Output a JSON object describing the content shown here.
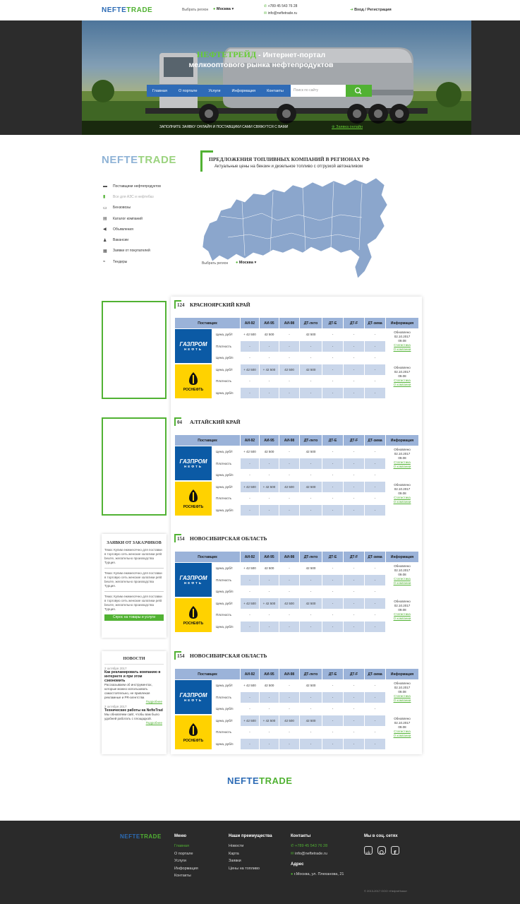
{
  "header": {
    "logo_part1": "NEFTE",
    "logo_part2": "TRADE",
    "region_label": "Выбрать регион",
    "region_value": "Москва",
    "phone": "+789 45 543 76 28",
    "email": "info@neftetrade.ru",
    "login": "Вход / Регистрация"
  },
  "hero": {
    "brand": "НЕФТЕТРЕЙД",
    "title_rest": " - Интернет-портал",
    "title_line2": "мелкооптового рынка нефтепродуктов",
    "nav": [
      "Главная",
      "О портале",
      "Услуги",
      "Информация",
      "Контакты"
    ],
    "search_placeholder": "Поиск по сайту",
    "strip_text": "ЗАПОЛНИТЕ ЗАЯВКУ ОНЛАЙН И ПОСТАВЩИКИ САМИ СВЯЖУТСЯ С ВАМИ",
    "strip_link": "Заявка онлайн"
  },
  "sidebar": {
    "logo_part1": "NEFTE",
    "logo_part2": "TRADE",
    "menu": [
      {
        "label": "Поставщики нефтепродуктов",
        "icon": "truck-icon"
      },
      {
        "label": "Все для АЗС и нефтебаз",
        "icon": "fuel-pump-icon"
      },
      {
        "label": "Бензовозы",
        "icon": "tanker-icon"
      },
      {
        "label": "Каталог компаний",
        "icon": "catalog-icon"
      },
      {
        "label": "Объявления",
        "icon": "megaphone-icon"
      },
      {
        "label": "Вакансии",
        "icon": "person-icon"
      },
      {
        "label": "Заявки от покупателей",
        "icon": "documents-icon"
      },
      {
        "label": "Тендеры",
        "icon": "handshake-icon"
      }
    ]
  },
  "offers": {
    "title": "ПРЕДЛОЖЕНИЯ ТОПЛИВНЫХ КОМПАНИЙ В РЕГИОНАХ РФ",
    "subtitle": "Актуальные цены на бензин и дизельное топливо с отгрузкой автоналивом",
    "region_label": "Выбрать регион",
    "region_value": "Москва"
  },
  "table_headers": [
    "Поставщик",
    "АИ-92",
    "АИ-95",
    "АИ-98",
    "ДТ-лето",
    "ДТ-Е",
    "ДТ-F",
    "ДТ-зима",
    "Информация"
  ],
  "row_labels": [
    "Цена, руб/т",
    "Плотность",
    "Цена, руб/л"
  ],
  "info": {
    "updated": "Обновлено 02.10.2017",
    "time": "09.08",
    "stats": "Статистика",
    "about": "О компании"
  },
  "suppliers": {
    "gazprom": {
      "line1": "ГАЗПРОМ",
      "line2": "НЕФТЬ"
    },
    "rosneft": {
      "line1": "РОСНЕФТЬ"
    }
  },
  "values": {
    "a": "+ 42 500",
    "b": "42 500",
    "dash": "-"
  },
  "sections": [
    {
      "num": "124",
      "name": "КРАСНОЯРСКИЙ КРАЙ"
    },
    {
      "num": "04",
      "name": "АЛТАЙСКИЙ КРАЙ"
    },
    {
      "num": "154",
      "name": "НОВОСИБИРСКАЯ ОБЛАСТЬ"
    },
    {
      "num": "154",
      "name": "НОВОСИБИРСКАЯ ОБЛАСТЬ"
    }
  ],
  "orders": {
    "title": "ЗАЯВКИ ОТ ЗАКАЗЧИКОВ",
    "items": [
      "Тема: Купим ежемесячно для поставки в торговую сеть женские халатики petit beurre, желательно производства Турция.",
      "Тема: Купим ежемесячно для поставки в торговую сеть женские халатики petit beurre, желательно производства Турция.",
      "Тема: Купим ежемесячно для поставки в торговую сеть женские халатики petit beurre, желательно производства Турция."
    ],
    "button": "Спрос на товары и услуги"
  },
  "news": {
    "title": "НОВОСТИ",
    "items": [
      {
        "date": "2 октября 2017",
        "head": "Как рекламировать компанию в интернете и при этом сэкономить",
        "text": "Рассказываем об инструментах, которые можно использовать самостоятельно, не привлекая рекламные и PR-агентства",
        "more": "Подробнее"
      },
      {
        "date": "2 октября 2017",
        "head": "Технические работы на NefteTrad",
        "text": "Мы обновляем сайт, чтобы вам было удобней работать с площадкой.",
        "more": "Подробнее"
      }
    ]
  },
  "footer": {
    "logo_part1": "NEFTE",
    "logo_part2": "TRADE",
    "menu_title": "Меню",
    "menu": [
      "Главная",
      "О портале",
      "Услуги",
      "Информация",
      "Контакты"
    ],
    "adv_title": "Наши преимущества",
    "adv": [
      "Новости",
      "Карта",
      "Заявки",
      "Цены на топливо"
    ],
    "contacts_title": "Контакты",
    "phone": "+789 45 543 76 28",
    "email": "info@neftetrade.ru",
    "address_title": "Адрес",
    "address": "г.Москва, ул. Плеханова, 21",
    "social_title": "Мы в соц. сетях",
    "social": [
      "vk-icon",
      "instagram-icon",
      "facebook-icon"
    ],
    "copyright": "© 2013-2017 ООО «НефтеНова»"
  },
  "colors": {
    "accent": "#51b233",
    "brand_blue": "#2c6bb5",
    "table_header": "#9bb3d9",
    "table_row": "#c9d6ea"
  }
}
